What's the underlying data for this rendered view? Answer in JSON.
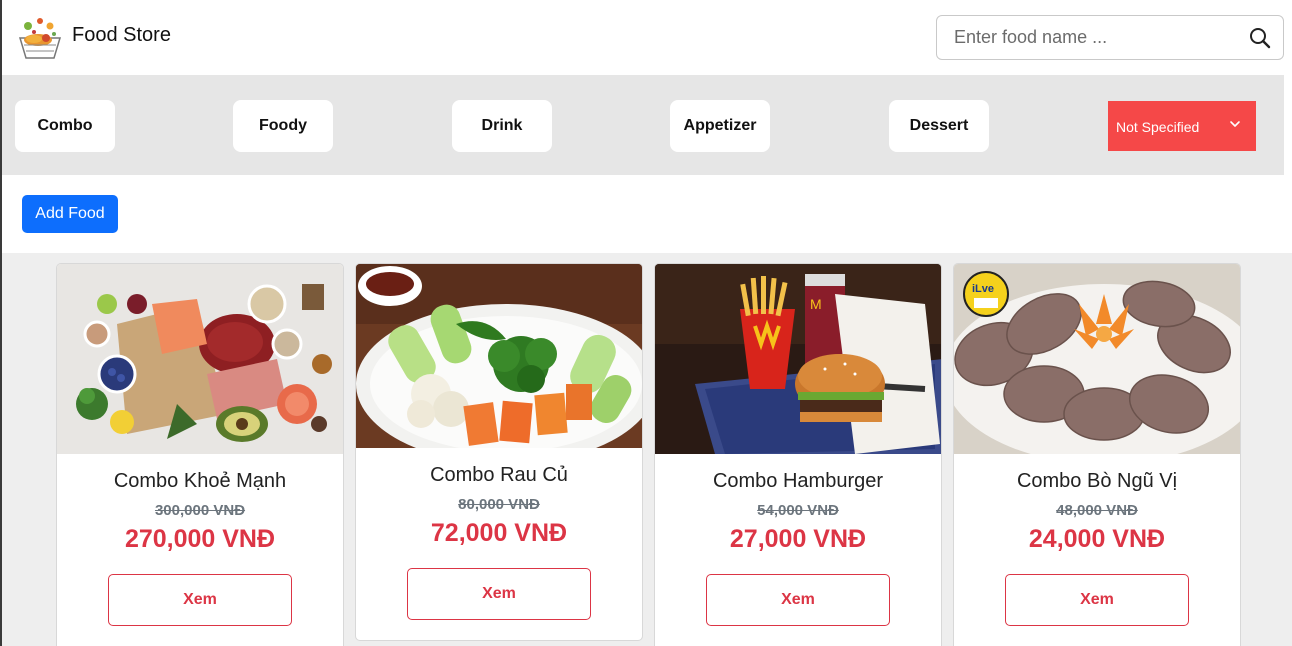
{
  "header": {
    "brand": "Food Store",
    "search_placeholder": "Enter food name ..."
  },
  "categories": [
    {
      "label": "Combo"
    },
    {
      "label": "Foody"
    },
    {
      "label": "Drink"
    },
    {
      "label": "Appetizer"
    },
    {
      "label": "Dessert"
    }
  ],
  "filter": {
    "selected": "Not Specified"
  },
  "toolbar": {
    "add_label": "Add Food"
  },
  "foods": [
    {
      "name": "Combo Khoẻ Mạnh",
      "old_price": "300,000 VNĐ",
      "price": "270,000 VNĐ",
      "view_label": "Xem"
    },
    {
      "name": "Combo Rau Củ",
      "old_price": "80,000 VNĐ",
      "price": "72,000 VNĐ",
      "view_label": "Xem"
    },
    {
      "name": "Combo Hamburger",
      "old_price": "54,000 VNĐ",
      "price": "27,000 VNĐ",
      "view_label": "Xem"
    },
    {
      "name": "Combo Bò Ngũ Vị",
      "old_price": "48,000 VNĐ",
      "price": "24,000 VNĐ",
      "view_label": "Xem"
    }
  ],
  "colors": {
    "primary": "#0d6efd",
    "danger": "#dc3545",
    "filter_bg": "#f54848",
    "category_bar": "#e6e6e6"
  },
  "icons": {
    "logo": "food-basket-logo",
    "search": "search-icon",
    "dropdown": "chevron-down-icon"
  }
}
